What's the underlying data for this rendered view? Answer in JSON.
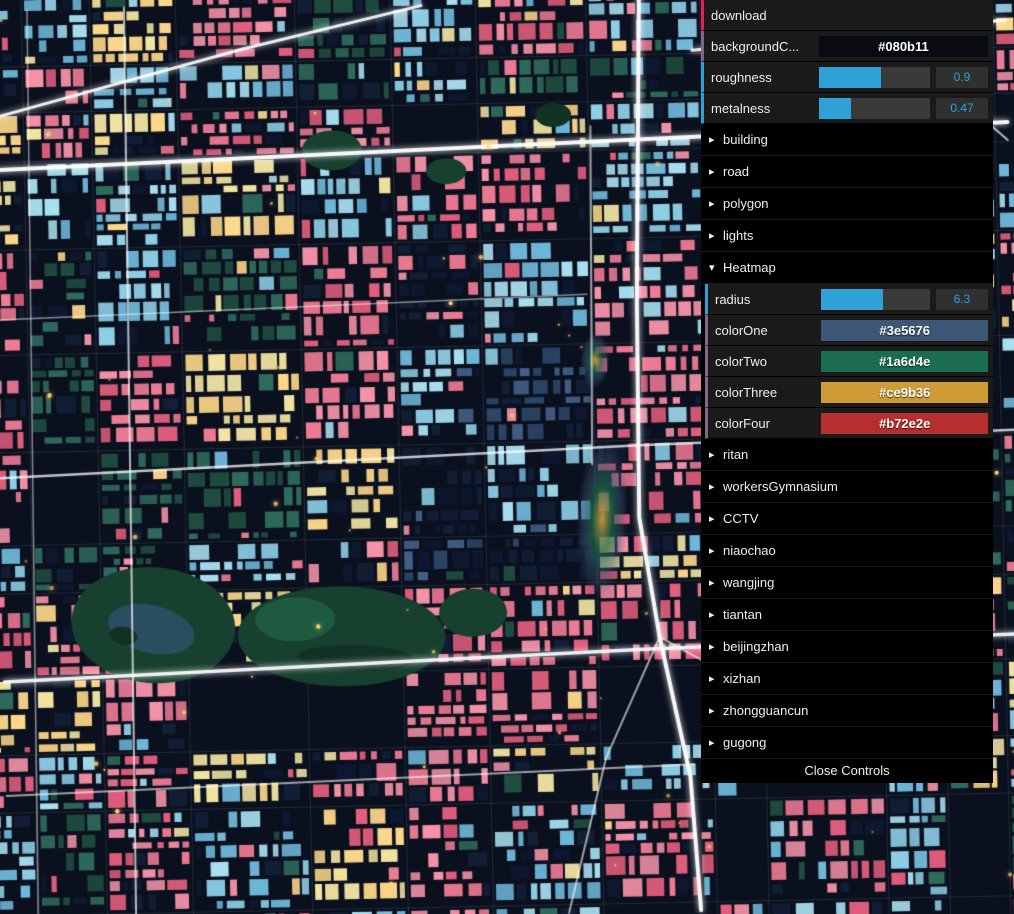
{
  "panel": {
    "close_label": "Close Controls",
    "accent": {
      "function_border": "#e61d5f",
      "number_border": "#2fa1d6",
      "color_border": "#806787",
      "slider_fill": "#2fa1d6",
      "value_text": "#2fa1d6"
    },
    "controls": [
      {
        "type": "function",
        "label": "download"
      },
      {
        "type": "color",
        "label": "backgroundC...",
        "value": "#080b11"
      },
      {
        "type": "number",
        "label": "roughness",
        "value": "0.9",
        "fraction": 0.56
      },
      {
        "type": "number",
        "label": "metalness",
        "value": "0.47",
        "fraction": 0.29
      },
      {
        "type": "folder",
        "label": "building",
        "state": "collapsed"
      },
      {
        "type": "folder",
        "label": "road",
        "state": "collapsed"
      },
      {
        "type": "folder",
        "label": "polygon",
        "state": "collapsed"
      },
      {
        "type": "folder",
        "label": "lights",
        "state": "collapsed"
      },
      {
        "type": "folder",
        "label": "Heatmap",
        "state": "expanded"
      },
      {
        "type": "number",
        "label": "radius",
        "value": "6.3",
        "fraction": 0.57,
        "group": "Heatmap"
      },
      {
        "type": "color",
        "label": "colorOne",
        "value": "#3e5676",
        "group": "Heatmap"
      },
      {
        "type": "color",
        "label": "colorTwo",
        "value": "#1a6d4e",
        "group": "Heatmap"
      },
      {
        "type": "color",
        "label": "colorThree",
        "value": "#ce9b36",
        "group": "Heatmap"
      },
      {
        "type": "color",
        "label": "colorFour",
        "value": "#b72e2e",
        "group": "Heatmap"
      },
      {
        "type": "folder",
        "label": "ritan",
        "state": "collapsed"
      },
      {
        "type": "folder",
        "label": "workersGymnasium",
        "state": "collapsed"
      },
      {
        "type": "folder",
        "label": "CCTV",
        "state": "collapsed"
      },
      {
        "type": "folder",
        "label": "niaochao",
        "state": "collapsed"
      },
      {
        "type": "folder",
        "label": "wangjing",
        "state": "collapsed"
      },
      {
        "type": "folder",
        "label": "tiantan",
        "state": "collapsed"
      },
      {
        "type": "folder",
        "label": "beijingzhan",
        "state": "collapsed"
      },
      {
        "type": "folder",
        "label": "xizhan",
        "state": "collapsed"
      },
      {
        "type": "folder",
        "label": "zhongguancun",
        "state": "collapsed"
      },
      {
        "type": "folder",
        "label": "gugong",
        "state": "collapsed"
      }
    ]
  },
  "map": {
    "background": "#0a101d",
    "palette": {
      "pink": [
        "#ef7b95",
        "#f693a9",
        "#e25e7d"
      ],
      "cyan": [
        "#8ecfe8",
        "#a9e0f2",
        "#6fb8da"
      ],
      "yellow": [
        "#f3e6a4",
        "#ffd98b"
      ],
      "teal": [
        "#2f6b5c",
        "#1f4d40"
      ],
      "slate": [
        "#44618a",
        "#2c4668"
      ],
      "dark": [
        "#121f36",
        "#0e1830"
      ],
      "road": "#ffffff",
      "park": "#17402e",
      "park_dark": "#113225",
      "water": "#2b4d60",
      "glow": "#ffd76e",
      "heatmap": [
        "#3e5676",
        "#1a6d4e",
        "#ce9b36",
        "#b72e2e"
      ]
    }
  }
}
